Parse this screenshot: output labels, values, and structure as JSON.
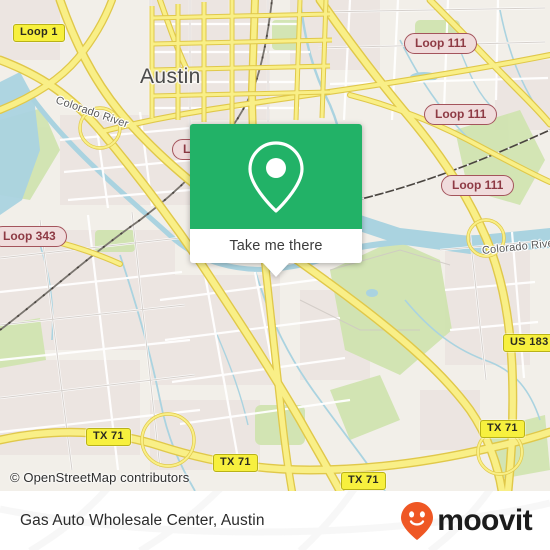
{
  "map": {
    "city_label": "Austin",
    "attribution": "© OpenStreetMap contributors",
    "river_labels": [
      {
        "text": "Colorado River"
      },
      {
        "text": "Colorado River"
      }
    ],
    "road_shields": [
      {
        "text": "Loop 1",
        "style": "yellow"
      },
      {
        "text": "Loop 111",
        "style": "red"
      },
      {
        "text": "Loop 111",
        "style": "red"
      },
      {
        "text": "Loop 111",
        "style": "red"
      },
      {
        "text": "Loop 343",
        "style": "red"
      },
      {
        "text": "Loop 343",
        "style": "red"
      },
      {
        "text": "US 183",
        "style": "yellow"
      },
      {
        "text": "TX 71",
        "style": "yellow"
      },
      {
        "text": "TX 71",
        "style": "yellow"
      },
      {
        "text": "TX 71",
        "style": "yellow"
      },
      {
        "text": "TX 71",
        "style": "yellow"
      }
    ],
    "colors": {
      "land": "#f2efe9",
      "urban": "#ece4e0",
      "park": "#cfe3ae",
      "water": "#aad3e0",
      "highway": "#f7e67e",
      "road": "#ffffff"
    }
  },
  "callout": {
    "icon": "location-pin-icon",
    "action_label": "Take me there",
    "accent_color": "#22b267"
  },
  "bottom_bar": {
    "place_name": "Gas Auto Wholesale Center, Austin",
    "brand_name": "moovit",
    "brand_icon": "moovit-smiley-pin-icon",
    "brand_color": "#ef5724"
  }
}
